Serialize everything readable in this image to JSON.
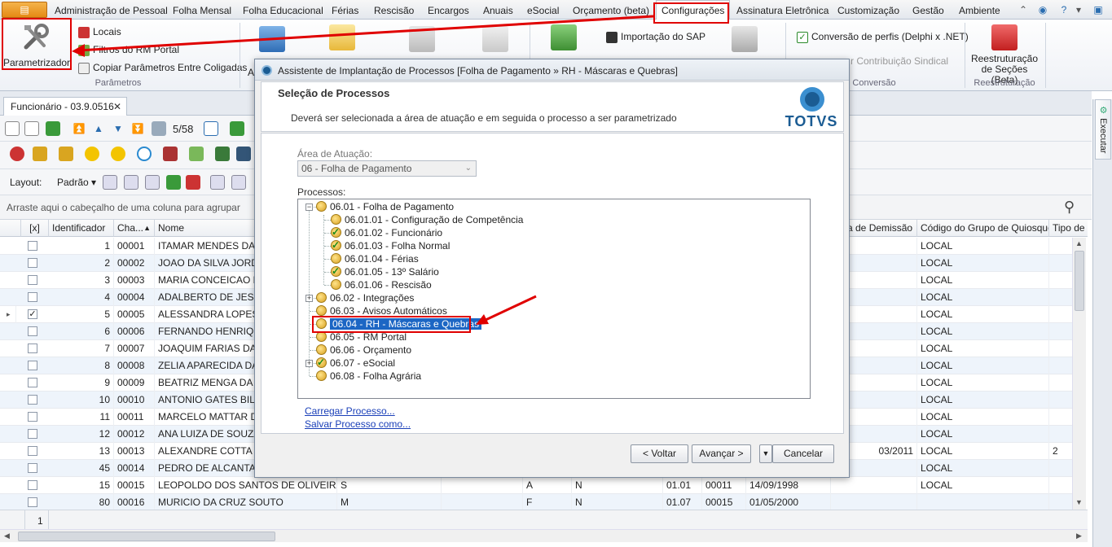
{
  "menubar": {
    "app_label": "▤",
    "items": [
      "Administração de Pessoal",
      "Folha Mensal",
      "Folha Educacional",
      "Férias",
      "Rescisão",
      "Encargos",
      "Anuais",
      "eSocial",
      "Orçamento (beta)",
      "Configurações",
      "Assinatura Eletrônica",
      "Customização",
      "Gestão",
      "Ambiente"
    ],
    "active": "Configurações"
  },
  "ribbon": {
    "parametros": {
      "big_label": "Parametrizador",
      "items": [
        "Locais",
        "Filtros do RM Portal",
        "Copiar Parâmetros Entre Coligadas"
      ],
      "group": "Parâmetros"
    },
    "partial_label_a": "A",
    "importacao_sap": "Importação do SAP",
    "conversao": {
      "items": [
        "Conversão de perfis (Delphi x .NET)",
        "r Contribuição Sindical"
      ],
      "group": "Conversão"
    },
    "reestruturacao": {
      "big_label_line1": "Reestruturação",
      "big_label_line2": "de Seções (Beta)",
      "group": "Reestruturação"
    }
  },
  "doc_tab": {
    "label": "Funcionário - 03.9.0516",
    "close": "✕"
  },
  "nav_toolbar": {
    "counter": "5/58"
  },
  "layout_bar": {
    "layout_label": "Layout:",
    "preset": "Padrão ▾"
  },
  "group_hint": "Arraste aqui o cabeçalho de uma coluna para agrupar",
  "grid": {
    "headers": [
      "[x]",
      "Identificador",
      "Cha...",
      "Nome",
      "a de Demissão",
      "Código do Grupo de Quiosque",
      "Tipo de D"
    ],
    "rows": [
      {
        "checked": false,
        "id": "1",
        "chapa": "00001",
        "nome": "ITAMAR MENDES DA SILV",
        "c1": "",
        "c2": "",
        "c3": "",
        "c4": "",
        "c5": "",
        "c6": "",
        "c7": "",
        "demissao": "",
        "quiosque": "LOCAL",
        "tipo": ""
      },
      {
        "checked": false,
        "id": "2",
        "chapa": "00002",
        "nome": "JOAO DA SILVA JORDAM",
        "c1": "",
        "c2": "",
        "c3": "",
        "c4": "",
        "c5": "",
        "c6": "",
        "c7": "",
        "demissao": "",
        "quiosque": "LOCAL",
        "tipo": ""
      },
      {
        "checked": false,
        "id": "3",
        "chapa": "00003",
        "nome": "MARIA CONCEICAO DE A",
        "c1": "",
        "c2": "",
        "c3": "",
        "c4": "",
        "c5": "",
        "c6": "",
        "c7": "",
        "demissao": "",
        "quiosque": "LOCAL",
        "tipo": ""
      },
      {
        "checked": false,
        "id": "4",
        "chapa": "00004",
        "nome": "ADALBERTO DE JESUS LI",
        "c1": "",
        "c2": "",
        "c3": "",
        "c4": "",
        "c5": "",
        "c6": "",
        "c7": "",
        "demissao": "",
        "quiosque": "LOCAL",
        "tipo": ""
      },
      {
        "checked": true,
        "id": "5",
        "chapa": "00005",
        "nome": "ALESSANDRA LOPES DE",
        "c1": "",
        "c2": "",
        "c3": "",
        "c4": "",
        "c5": "",
        "c6": "",
        "c7": "",
        "demissao": "",
        "quiosque": "LOCAL",
        "tipo": ""
      },
      {
        "checked": false,
        "id": "6",
        "chapa": "00006",
        "nome": "FERNANDO HENRIQUE V",
        "c1": "",
        "c2": "",
        "c3": "",
        "c4": "",
        "c5": "",
        "c6": "",
        "c7": "",
        "demissao": "",
        "quiosque": "LOCAL",
        "tipo": ""
      },
      {
        "checked": false,
        "id": "7",
        "chapa": "00007",
        "nome": "JOAQUIM FARIAS DAMA",
        "c1": "",
        "c2": "",
        "c3": "",
        "c4": "",
        "c5": "",
        "c6": "",
        "c7": "",
        "demissao": "",
        "quiosque": "LOCAL",
        "tipo": ""
      },
      {
        "checked": false,
        "id": "8",
        "chapa": "00008",
        "nome": "ZELIA APARECIDA DA SI",
        "c1": "",
        "c2": "",
        "c3": "",
        "c4": "",
        "c5": "",
        "c6": "",
        "c7": "",
        "demissao": "",
        "quiosque": "LOCAL",
        "tipo": ""
      },
      {
        "checked": false,
        "id": "9",
        "chapa": "00009",
        "nome": "BEATRIZ MENGA DA LUZ",
        "c1": "",
        "c2": "",
        "c3": "",
        "c4": "",
        "c5": "",
        "c6": "",
        "c7": "",
        "demissao": "",
        "quiosque": "LOCAL",
        "tipo": ""
      },
      {
        "checked": false,
        "id": "10",
        "chapa": "00010",
        "nome": "ANTONIO GATES BILL",
        "c1": "",
        "c2": "",
        "c3": "",
        "c4": "",
        "c5": "",
        "c6": "",
        "c7": "",
        "demissao": "",
        "quiosque": "LOCAL",
        "tipo": ""
      },
      {
        "checked": false,
        "id": "11",
        "chapa": "00011",
        "nome": "MARCELO MATTAR DINIZ",
        "c1": "",
        "c2": "",
        "c3": "",
        "c4": "",
        "c5": "",
        "c6": "",
        "c7": "",
        "demissao": "",
        "quiosque": "LOCAL",
        "tipo": ""
      },
      {
        "checked": false,
        "id": "12",
        "chapa": "00012",
        "nome": "ANA LUIZA  DE SOUZA P",
        "c1": "",
        "c2": "",
        "c3": "",
        "c4": "",
        "c5": "",
        "c6": "",
        "c7": "",
        "demissao": "",
        "quiosque": "LOCAL",
        "tipo": ""
      },
      {
        "checked": false,
        "id": "13",
        "chapa": "00013",
        "nome": "ALEXANDRE COTTA LEAO",
        "c1": "",
        "c2": "",
        "c3": "",
        "c4": "",
        "c5": "",
        "c6": "",
        "c7": "",
        "demissao": "03/2011",
        "quiosque": "LOCAL",
        "tipo": "2"
      },
      {
        "checked": false,
        "id": "45",
        "chapa": "00014",
        "nome": "PEDRO DE ALCANTARA",
        "c1": "",
        "c2": "",
        "c3": "",
        "c4": "",
        "c5": "",
        "c6": "",
        "c7": "",
        "demissao": "",
        "quiosque": "LOCAL",
        "tipo": ""
      },
      {
        "checked": false,
        "id": "15",
        "chapa": "00015",
        "nome": "LEOPOLDO DOS SANTOS DE OLIVEIRA NE...",
        "c1": "S",
        "c2": "A",
        "c3": "N",
        "c4": "01.01",
        "c5": "00011",
        "c6": "14/09/1998",
        "c7": "",
        "demissao": "",
        "quiosque": "LOCAL",
        "tipo": ""
      },
      {
        "checked": false,
        "id": "80",
        "chapa": "00016",
        "nome": "MURICIO DA CRUZ SOUTO",
        "c1": "M",
        "c2": "F",
        "c3": "N",
        "c4": "01.07",
        "c5": "00015",
        "c6": "01/05/2000",
        "c7": "",
        "demissao": "",
        "quiosque": "",
        "tipo": ""
      }
    ],
    "footer_count": "1"
  },
  "side_panel": {
    "label": "Executar"
  },
  "dialog": {
    "title": "Assistente de Implantação de Processos [Folha de Pagamento » RH - Máscaras e Quebras]",
    "header_title": "Seleção de Processos",
    "header_desc": "Deverá ser selecionada a área de atuação e em seguida o processo a ser parametrizado",
    "brand": "TOTVS",
    "area_label": "Área de Atuação:",
    "area_value": "06 - Folha de Pagamento",
    "processes_label": "Processos:",
    "tree": [
      {
        "label": "06.01 - Folha de Pagamento",
        "level": 0,
        "expander": "−",
        "ok": false
      },
      {
        "label": "06.01.01 - Configuração de Competência",
        "level": 1,
        "ok": false
      },
      {
        "label": "06.01.02 - Funcionário",
        "level": 1,
        "ok": true
      },
      {
        "label": "06.01.03 - Folha Normal",
        "level": 1,
        "ok": true
      },
      {
        "label": "06.01.04 - Férias",
        "level": 1,
        "ok": false
      },
      {
        "label": "06.01.05 - 13º Salário",
        "level": 1,
        "ok": true
      },
      {
        "label": "06.01.06 - Rescisão",
        "level": 1,
        "ok": false
      },
      {
        "label": "06.02 - Integrações",
        "level": 0,
        "expander": "+",
        "ok": false
      },
      {
        "label": "06.03 - Avisos Automáticos",
        "level": 0,
        "ok": false
      },
      {
        "label": "06.04 - RH - Máscaras e Quebras",
        "level": 0,
        "ok": false,
        "selected": true
      },
      {
        "label": "06.05 - RM Portal",
        "level": 0,
        "ok": false
      },
      {
        "label": "06.06 - Orçamento",
        "level": 0,
        "ok": false
      },
      {
        "label": "06.07 - eSocial",
        "level": 0,
        "expander": "+",
        "ok": true
      },
      {
        "label": "06.08 - Folha Agrária",
        "level": 0,
        "ok": false
      }
    ],
    "link_load": "Carregar Processo...",
    "link_save": "Salvar Processo como...",
    "btn_back": "< Voltar",
    "btn_next": "Avançar >",
    "btn_cancel": "Cancelar"
  },
  "colors": {
    "accent": "#1c66c4",
    "annotation": "#e00000",
    "brand": "#1b5c93"
  }
}
